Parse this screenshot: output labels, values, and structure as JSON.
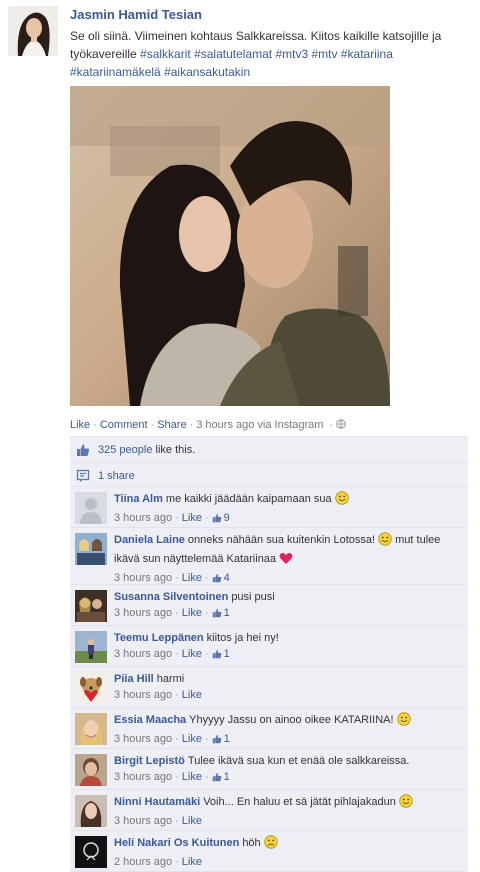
{
  "post": {
    "author": "Jasmin Hamid Tesian",
    "text_plain": "Se oli siinä. Viimeinen kohtaus Salkkareissa. Kiitos kaikille katsojille ja työkavereille",
    "hashtags": [
      "#salkkarit",
      "#salatutelamat",
      "#mtv3",
      "#mtv",
      "#katariina",
      "#katariinamäkelä",
      "#aikansakutakin"
    ],
    "actions": {
      "like": "Like",
      "comment": "Comment",
      "share": "Share"
    },
    "time": "3 hours ago via Instagram",
    "privacy_icon": "globe-icon"
  },
  "ufi": {
    "likes": {
      "link": "325 people",
      "suffix": "like this."
    },
    "shares": "1 share"
  },
  "comments": [
    {
      "name": "Tiina Alm",
      "text": "me kaikki jäädään kaipamaan sua",
      "emoji": "smile",
      "time": "3 hours ago",
      "like": "Like",
      "likes": "9"
    },
    {
      "name": "Daniela Laine",
      "text": "onneks nähään sua kuitenkin Lotossa!",
      "emoji": "smile",
      "text2": "mut tulee ikävä sun näyttelemää Katariinaa",
      "emoji2": "heart",
      "time": "3 hours ago",
      "like": "Like",
      "likes": "4"
    },
    {
      "name": "Susanna Silventoinen",
      "text": "pusi pusi",
      "emoji": "",
      "time": "3 hours ago",
      "like": "Like",
      "likes": "1"
    },
    {
      "name": "Teemu Leppänen",
      "text": "kiitos ja hei ny!",
      "emoji": "",
      "time": "3 hours ago",
      "like": "Like",
      "likes": "1"
    },
    {
      "name": "Piia Hill",
      "text": "harmi",
      "emoji": "",
      "time": "3 hours ago",
      "like": "Like",
      "likes": ""
    },
    {
      "name": "Essia Maacha",
      "text": "Yhyyyy Jassu on ainoo oikee KATARIINA!",
      "emoji": "smile",
      "time": "3 hours ago",
      "like": "Like",
      "likes": "1"
    },
    {
      "name": "Birgit Lepistö",
      "text": "Tulee ikävä sua kun et enää ole salkkareissa.",
      "emoji": "",
      "time": "3 hours ago",
      "like": "Like",
      "likes": "1"
    },
    {
      "name": "Ninni Hautamäki",
      "text": "Voih... En haluu et sä jätät pihlajakadun",
      "emoji": "smile",
      "time": "3 hours ago",
      "like": "Like",
      "likes": ""
    },
    {
      "name": "Heli Nakari Os Kuitunen",
      "text": "höh",
      "emoji": "frown",
      "time": "2 hours ago",
      "like": "Like",
      "likes": ""
    }
  ],
  "colors": {
    "link": "#3b5998",
    "ufi_bg": "#edeff4",
    "meta": "#777777",
    "heart": "#e0245e"
  }
}
